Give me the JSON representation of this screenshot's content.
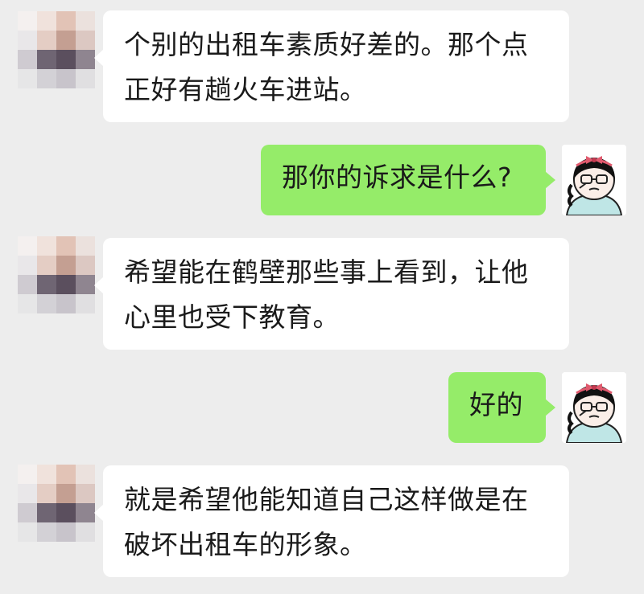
{
  "messages": [
    {
      "side": "left",
      "lines": [
        "个别的出租车素质好差的。那个点",
        "正好有趟火车进站。"
      ]
    },
    {
      "side": "right",
      "lines": [
        "那你的诉求是什么?"
      ]
    },
    {
      "side": "left",
      "lines": [
        "希望能在鹤壁那些事上看到，让他",
        "心里也受下教育。"
      ]
    },
    {
      "side": "right",
      "lines": [
        "好的"
      ]
    },
    {
      "side": "left",
      "lines": [
        "就是希望他能知道自己这样做是在",
        "破坏出租车的形象。"
      ]
    }
  ],
  "colors": {
    "background": "#ededed",
    "incoming_bubble": "#ffffff",
    "outgoing_bubble": "#95ec69"
  },
  "icons": {
    "contact_avatar": "pixelated-avatar-icon",
    "my_avatar": "cartoon-girl-avatar-icon"
  }
}
